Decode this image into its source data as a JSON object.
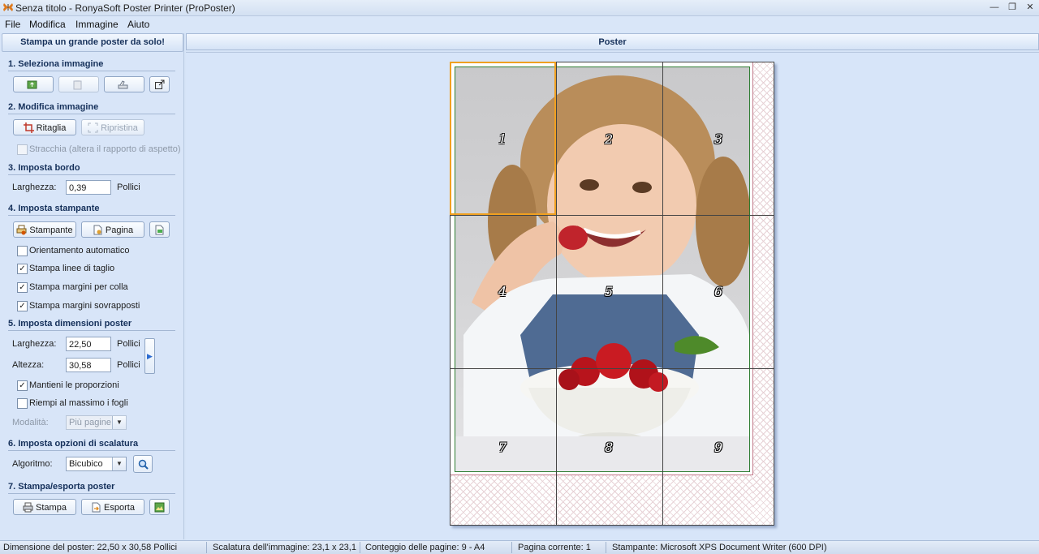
{
  "window": {
    "title": "Senza titolo - RonyaSoft Poster Printer (ProPoster)"
  },
  "menu": [
    "File",
    "Modifica",
    "Immagine",
    "Aiuto"
  ],
  "left_panel": {
    "header": "Stampa un grande poster da solo!",
    "section1": {
      "title": "1. Seleziona immagine"
    },
    "section2": {
      "title": "2. Modifica immagine",
      "crop_label": "Ritaglia",
      "restore_label": "Ripristina",
      "stretch_label": "Stracchia (altera il rapporto di aspetto)"
    },
    "section3": {
      "title": "3. Imposta bordo",
      "width_label": "Larghezza:",
      "width_value": "0,39",
      "unit": "Pollici"
    },
    "section4": {
      "title": "4. Imposta stampante",
      "printer_label": "Stampante",
      "page_label": "Pagina",
      "auto_orient": "Orientamento automatico",
      "cut_lines": "Stampa linee di taglio",
      "glue_margins": "Stampa margini per colla",
      "overlap_margins": "Stampa margini sovrapposti"
    },
    "section5": {
      "title": "5. Imposta dimensioni poster",
      "width_label": "Larghezza:",
      "width_value": "22,50",
      "height_label": "Altezza:",
      "height_value": "30,58",
      "unit": "Pollici",
      "keep_ratio": "Mantieni le proporzioni",
      "fill_sheets": "Riempi al massimo i fogli",
      "mode_label": "Modalità:",
      "mode_value": "Più pagine"
    },
    "section6": {
      "title": "6. Imposta opzioni di scalatura",
      "algo_label": "Algoritmo:",
      "algo_value": "Bicubico"
    },
    "section7": {
      "title": "7. Stampa/esporta poster",
      "print_label": "Stampa",
      "export_label": "Esporta"
    }
  },
  "poster": {
    "header": "Poster",
    "pages": [
      "1",
      "2",
      "3",
      "4",
      "5",
      "6",
      "7",
      "8",
      "9"
    ]
  },
  "status": {
    "size": "Dimensione del poster: 22,50 x 30,58 Pollici",
    "scale": "Scalatura dell'immagine: 23,1 x 23,1",
    "pages": "Conteggio delle pagine: 9 - A4",
    "current": "Pagina corrente: 1",
    "printer": "Stampante: Microsoft XPS Document Writer (600 DPI)"
  },
  "checkbox_state": {
    "stretch": false,
    "auto_orient": false,
    "cut_lines": true,
    "glue_margins": true,
    "overlap_margins": true,
    "keep_ratio": true,
    "fill_sheets": false
  },
  "colors": {
    "accent": "#f0a020",
    "panel": "#d8e5f8",
    "frame": "#2e7d32",
    "margin": "#c2798a"
  }
}
